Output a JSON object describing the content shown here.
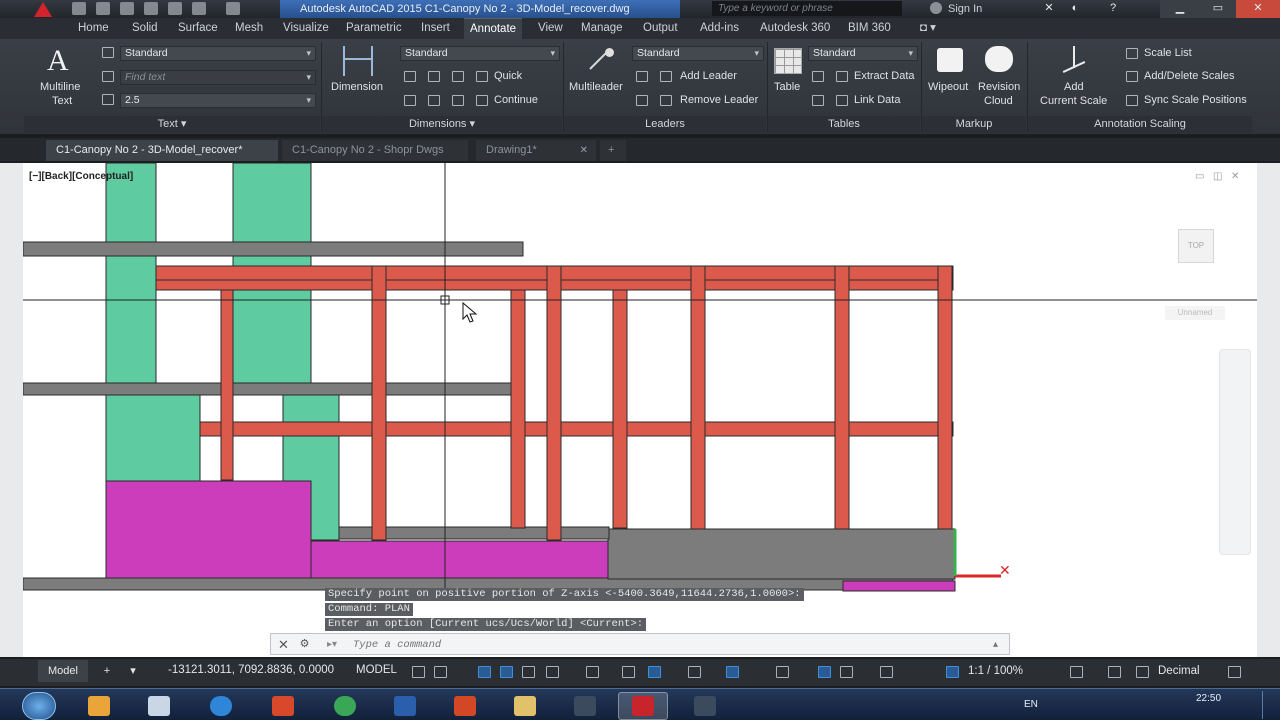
{
  "window": {
    "title": "Autodesk AutoCAD 2015    C1-Canopy No 2 - 3D-Model_recover.dwg",
    "search_placeholder": "Type a keyword or phrase",
    "signin_label": "Sign In"
  },
  "ribbon_tabs": [
    "Home",
    "Solid",
    "Surface",
    "Mesh",
    "Visualize",
    "Parametric",
    "Insert",
    "Annotate",
    "View",
    "Manage",
    "Output",
    "Add-ins",
    "Autodesk 360",
    "BIM 360"
  ],
  "active_tab": "Annotate",
  "text_panel": {
    "multiline_label": "Multiline",
    "multiline_label2": "Text",
    "style_value": "Standard",
    "find_placeholder": "Find text",
    "height_value": "2.5",
    "title": "Text"
  },
  "dimensions_panel": {
    "dimension_label": "Dimension",
    "style_value": "Standard",
    "quick_label": "Quick",
    "continue_label": "Continue",
    "title": "Dimensions"
  },
  "leaders_panel": {
    "multileader_label": "Multileader",
    "style_value": "Standard",
    "add_leader_label": "Add Leader",
    "remove_leader_label": "Remove Leader",
    "title": "Leaders"
  },
  "tables_panel": {
    "table_label": "Table",
    "style_value": "Standard",
    "extract_data_label": "Extract Data",
    "link_data_label": "Link Data",
    "title": "Tables"
  },
  "markup_panel": {
    "wipeout_label": "Wipeout",
    "revision_label": "Revision",
    "revision_label2": "Cloud",
    "title": "Markup"
  },
  "scaling_panel": {
    "add_scale_label": "Add",
    "add_scale_label2": "Current Scale",
    "scale_list_label": "Scale List",
    "add_delete_label": "Add/Delete Scales",
    "sync_label": "Sync Scale Positions",
    "title": "Annotation Scaling"
  },
  "file_tabs": [
    {
      "label": "C1-Canopy No 2 - 3D-Model_recover*",
      "active": true
    },
    {
      "label": "C1-Canopy No 2 - Shopr Dwgs",
      "active": false
    },
    {
      "label": "Drawing1*",
      "active": false
    }
  ],
  "viewport": {
    "label": "[−][Back][Conceptual]",
    "viewcube_label": "TOP",
    "ucs_label": "Unnamed"
  },
  "command": {
    "history": [
      "Specify point on positive portion of Z-axis <-5400.3649,11644.2736,1.0000>:",
      "Command: PLAN",
      "Enter an option [Current ucs/Ucs/World] <Current>:"
    ],
    "input_placeholder": "Type a command"
  },
  "status": {
    "model_tab": "Model",
    "coords": "-13121.3011, 7092.8836, 0.0000",
    "space": "MODEL",
    "annotation_scale": "1:1 / 100%",
    "units": "Decimal"
  },
  "taskbar": {
    "language": "EN",
    "clock": "22:50"
  },
  "colors": {
    "steel": "#dc5a4c",
    "wall": "#5ecba0",
    "slab": "#7c7c7c",
    "magenta": "#cc3dbb",
    "accent": "#3d8fe0"
  }
}
